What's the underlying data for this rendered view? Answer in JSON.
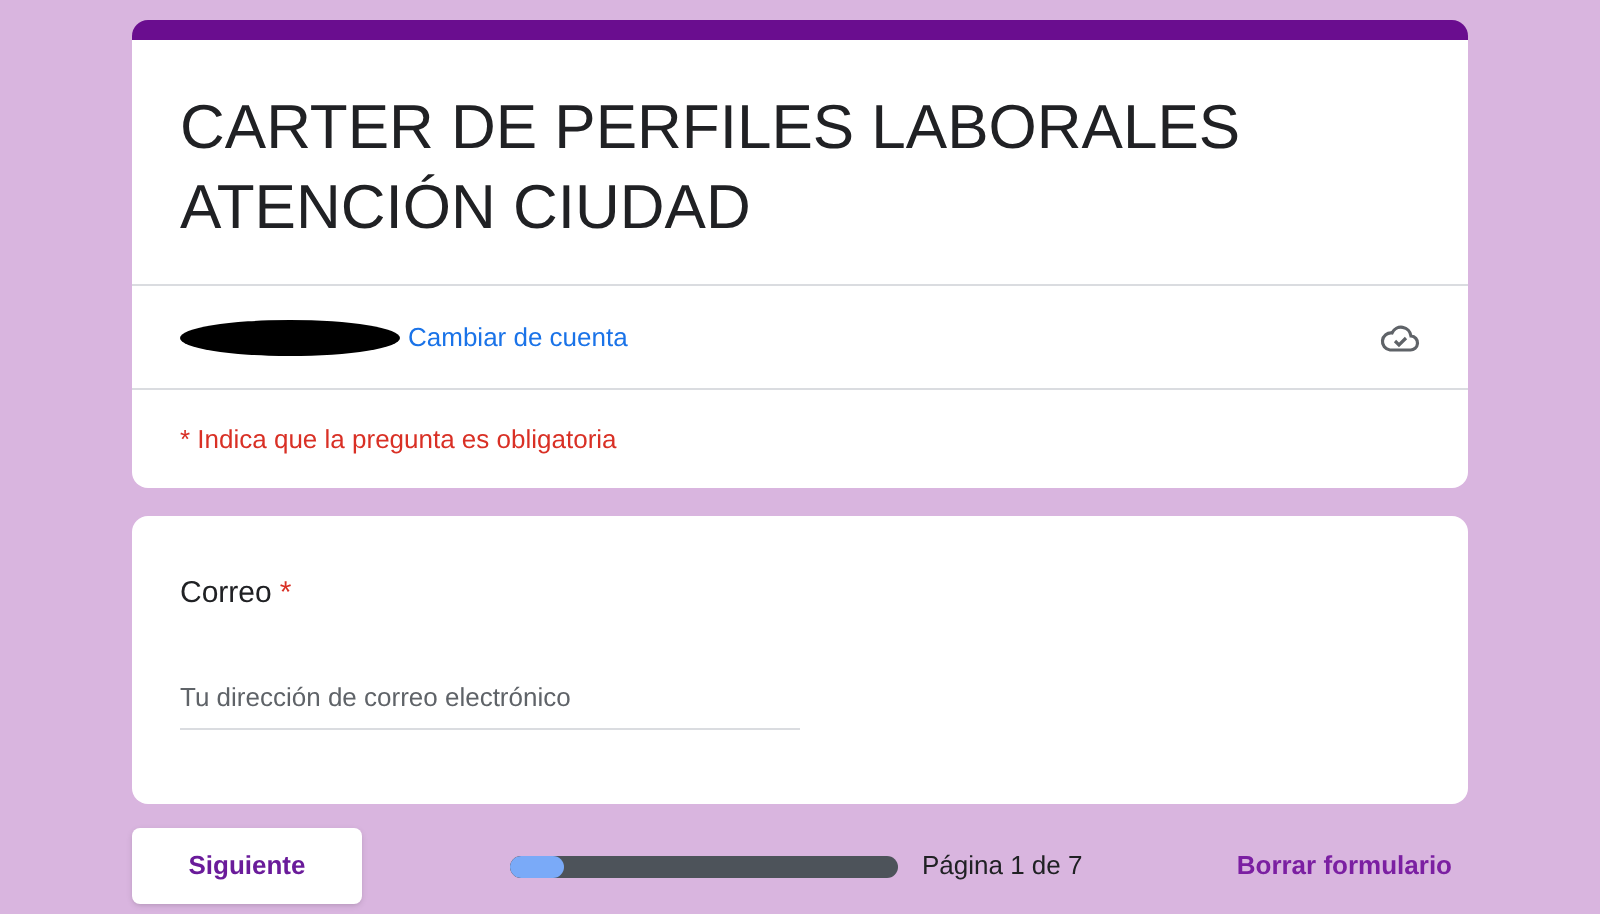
{
  "header": {
    "title": "CARTER DE PERFILES LABORALES ATENCIÓN CIUDAD",
    "switch_account": "Cambiar de cuenta",
    "required_note": "* Indica que la pregunta es obligatoria"
  },
  "question": {
    "label": "Correo",
    "required": true,
    "required_mark": "*",
    "placeholder": "Tu dirección de correo electrónico"
  },
  "footer": {
    "next_button": "Siguiente",
    "progress": {
      "level": 0.14
    },
    "page_label": "Página 1 de 7",
    "clear_button": "Borrar formulario"
  }
}
